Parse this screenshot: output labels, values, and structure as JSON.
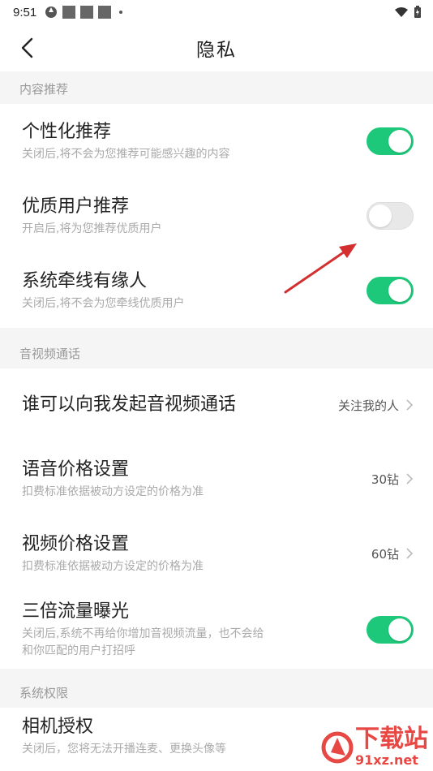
{
  "status_bar": {
    "time": "9:51"
  },
  "header": {
    "title": "隐私"
  },
  "sections": [
    {
      "header": "内容推荐",
      "rows": [
        {
          "title": "个性化推荐",
          "subtitle": "关闭后,将不会为您推荐可能感兴趣的内容",
          "toggle": true
        },
        {
          "title": "优质用户推荐",
          "subtitle": "开启后,将为您推荐优质用户",
          "toggle": false
        },
        {
          "title": "系统牵线有缘人",
          "subtitle": "关闭后,将不会为您牵线优质用户",
          "toggle": true
        }
      ]
    },
    {
      "header": "音视频通话",
      "rows": [
        {
          "title": "谁可以向我发起音视频通话",
          "value": "关注我的人"
        },
        {
          "title": "语音价格设置",
          "subtitle": "扣费标准依据被动方设定的价格为准",
          "value": "30钻"
        },
        {
          "title": "视频价格设置",
          "subtitle": "扣费标准依据被动方设定的价格为准",
          "value": "60钻"
        },
        {
          "title": "三倍流量曝光",
          "subtitle_line1": "关闭后,系统不再给你增加音视频流量，也不会给",
          "subtitle_line2": "和你匹配的用户打招呼",
          "toggle": true
        }
      ]
    },
    {
      "header": "系统权限",
      "rows": [
        {
          "title": "相机授权",
          "subtitle": "关闭后，您将无法开播连麦、更换头像等"
        }
      ]
    }
  ],
  "watermark": {
    "text": "下载站",
    "sub": "91xz.net"
  },
  "colors": {
    "toggle_on": "#1ec87a",
    "toggle_off": "#e8e8e8",
    "section_bg": "#f5f5f5",
    "annotation_arrow": "#d32f2f"
  },
  "icons": [
    "back-arrow-icon",
    "chevron-right-icon",
    "wifi-icon",
    "battery-icon",
    "signal-icon"
  ]
}
